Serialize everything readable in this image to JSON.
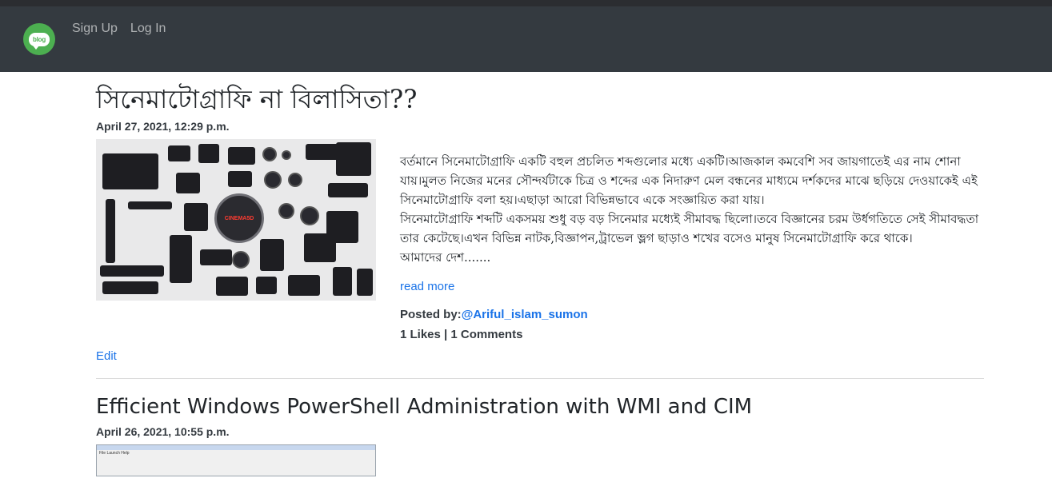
{
  "nav": {
    "logo_text": "blog",
    "links": [
      "Sign Up",
      "Log In"
    ]
  },
  "posts": [
    {
      "title": "সিনেমাটোগ্রাফি না বিলাসিতা??",
      "date": "April 27, 2021, 12:29 p.m.",
      "thumb_label": "CINEMA5D",
      "excerpt": "বর্তমানে সিনেমাটোগ্রাফি একটি বহুল প্রচলিত শব্দগুলোর মধ্যে একটি।আজকাল কমবেশি সব জায়গাতেই এর নাম শোনা যায়।মুলত নিজের মনের সৌন্দর্যটাকে চিত্র ও শব্দের এক নিদারুণ মেল বন্ধনের মাধ্যমে দর্শকদের মাঝে ছড়িয়ে দেওয়াকেই এই সিনেমাটোগ্রাফি বলা হয়।এছাড়া আরো বিভিন্নভাবে একে সংজ্ঞায়িত করা যায়।\nসিনেমাটোগ্রাফি শব্দটি একসময় শুধু বড় বড় সিনেমার মধ্যেই সীমাবদ্ধ ছিলো।তবে বিজ্ঞানের চরম উর্ধগতিতে সেই সীমাবদ্ধতা তার কেটেছে।এখন বিভিন্ন নাটক,বিজ্ঞাপন,ট্রাভেল ভ্লগ ছাড়াও শখের বসেও মানুষ সিনেমাটোগ্রাফি করে থাকে।\nআমাদের দেশ.......",
      "read_more": "read more",
      "posted_by_label": "Posted by:",
      "author": "@Ariful_islam_sumon",
      "stats": "1 Likes | 1 Comments",
      "edit": "Edit"
    },
    {
      "title": "Efficient Windows PowerShell Administration with WMI and CIM",
      "date": "April 26, 2021, 10:55 p.m.",
      "thumb_menu": "File  Launch  Help"
    }
  ]
}
